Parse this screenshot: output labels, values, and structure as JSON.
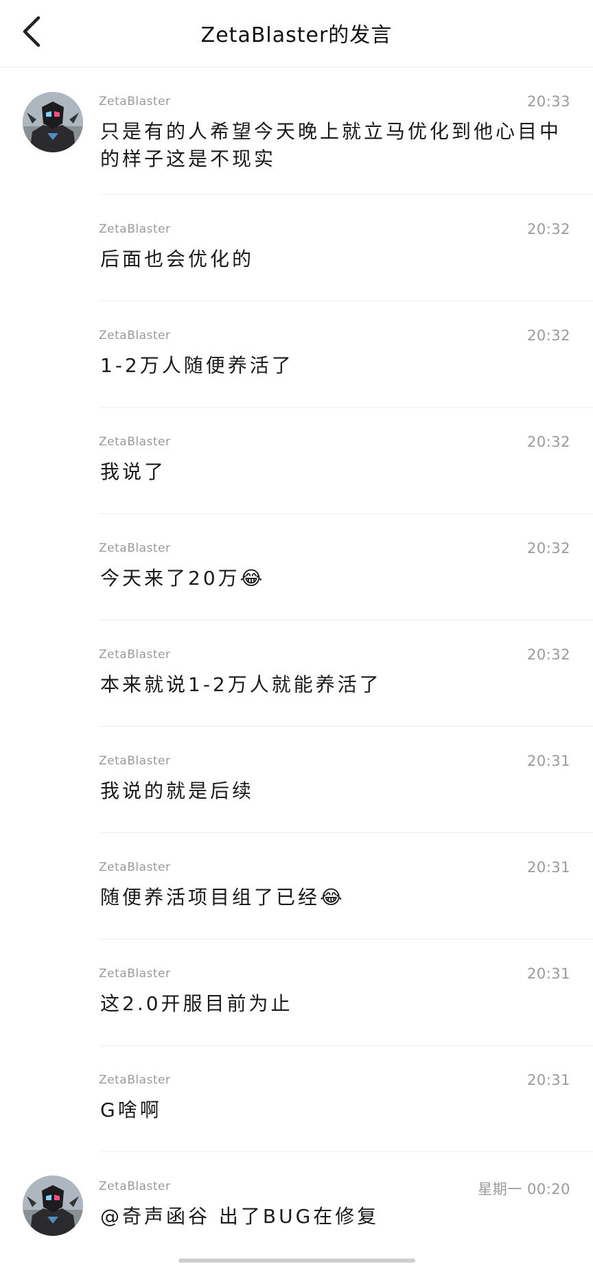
{
  "header": {
    "title": "ZetaBlaster的发言"
  },
  "messages": [
    {
      "name": "ZetaBlaster",
      "time": "20:33",
      "text": "只是有的人希望今天晚上就立马优化到他心目中的样子这是不现实",
      "has_avatar": true
    },
    {
      "name": "ZetaBlaster",
      "time": "20:32",
      "text": "后面也会优化的",
      "has_avatar": false
    },
    {
      "name": "ZetaBlaster",
      "time": "20:32",
      "text": "1-2万人随便养活了",
      "has_avatar": false
    },
    {
      "name": "ZetaBlaster",
      "time": "20:32",
      "text": "我说了",
      "has_avatar": false
    },
    {
      "name": "ZetaBlaster",
      "time": "20:32",
      "text": "今天来了20万😂",
      "has_avatar": false
    },
    {
      "name": "ZetaBlaster",
      "time": "20:32",
      "text": "本来就说1-2万人就能养活了",
      "has_avatar": false
    },
    {
      "name": "ZetaBlaster",
      "time": "20:31",
      "text": "我说的就是后续",
      "has_avatar": false
    },
    {
      "name": "ZetaBlaster",
      "time": "20:31",
      "text": "随便养活项目组了已经😂",
      "has_avatar": false
    },
    {
      "name": "ZetaBlaster",
      "time": "20:31",
      "text": "这2.0开服目前为止",
      "has_avatar": false
    },
    {
      "name": "ZetaBlaster",
      "time": "20:31",
      "text": "G啥啊",
      "has_avatar": false
    },
    {
      "name": "ZetaBlaster",
      "time": "星期一 00:20",
      "text": "@奇声函谷 出了BUG在修复",
      "has_avatar": true
    }
  ],
  "icons": {
    "back": "chevron-left-icon",
    "avatar": "avatar-armored-rider"
  },
  "colors": {
    "background": "#ffffff",
    "meta_text": "#9a9a9a",
    "body_text": "#1a1a1a",
    "divider": "#efefef"
  }
}
